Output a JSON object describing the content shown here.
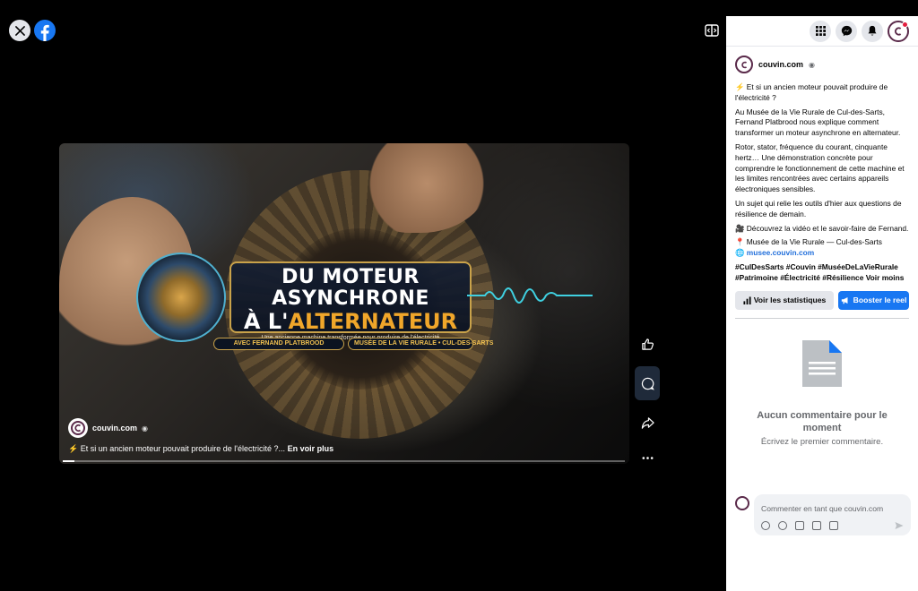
{
  "viewer": {
    "video": {
      "banner_line1": "DU MOTEUR ASYNCHRONE",
      "banner_line2_a": "À L'",
      "banner_line2_b": "ALTERNATEUR",
      "banner_sub": "Une ancienne machine transformée pour produire de l'électricité",
      "pill_left": "AVEC FERNAND PLATBROOD",
      "pill_right": "MUSÉE DE LA VIE RURALE • CUL-DES-SARTS",
      "author": "couvin.com",
      "caption": "⚡ Et si un ancien moteur pouvait produire de l'électricité ?...",
      "see_more": "En voir plus",
      "progress": 0.02
    }
  },
  "panel": {
    "author": "couvin.com",
    "paragraphs": [
      "⚡ Et si un ancien moteur pouvait produire de l'électricité ?",
      "Au Musée de la Vie Rurale de Cul-des-Sarts, Fernand Platbrood nous explique comment transformer un moteur asynchrone en alternateur.",
      "Rotor, stator, fréquence du courant, cinquante hertz… Une démonstration concrète pour comprendre le fonctionnement de cette machine et les limites rencontrées avec certains appareils électroniques sensibles.",
      "Un sujet qui relie les outils d'hier aux questions de résilience de demain.",
      "🎥 Découvrez la vidéo et le savoir-faire de Fernand."
    ],
    "location": "📍 Musée de la Vie Rurale — Cul-des-Sarts",
    "link_prefix": "🌐 ",
    "link": "musee.couvin.com",
    "tags": "#CulDesSarts #Couvin #MuséeDeLaVieRurale #Patrimoine #Électricité #Résilience Voir moins",
    "stats_button": "Voir les statistiques",
    "boost_button": "Booster le reel",
    "empty_title": "Aucun commentaire pour le moment",
    "empty_sub": "Écrivez le premier commentaire.",
    "comment_placeholder": "Commenter en tant que couvin.com"
  },
  "colors": {
    "brand": "#1877f2",
    "accent_gold": "#f0a62a"
  }
}
